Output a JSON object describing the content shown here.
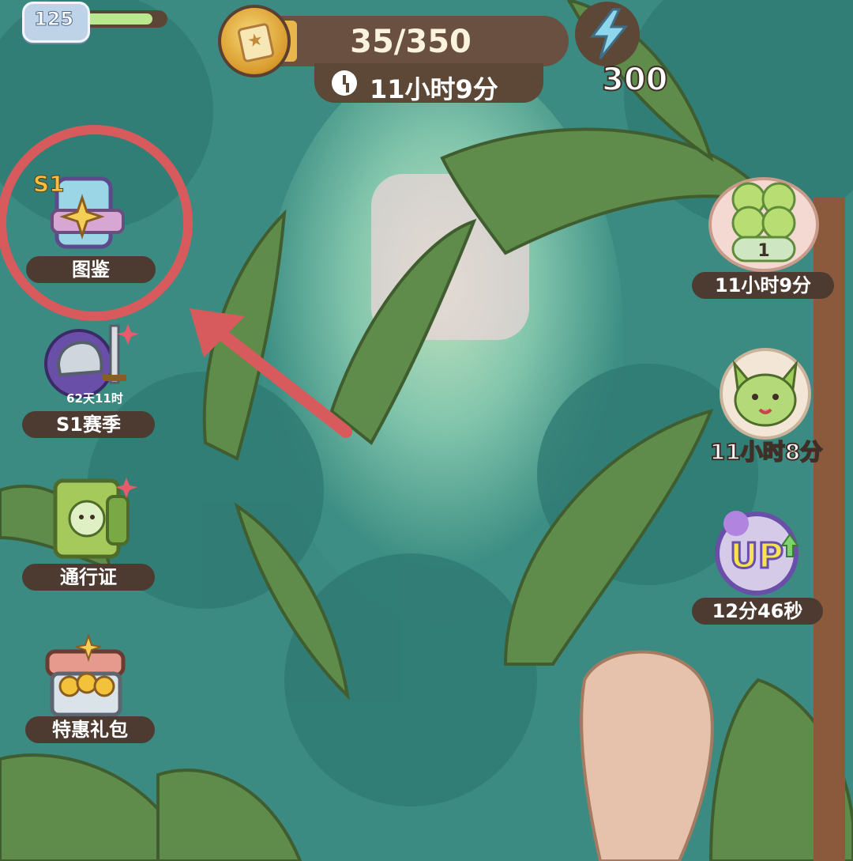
{
  "player": {
    "level": "125",
    "xp_fraction": 0.85
  },
  "energy_bar": {
    "progress_text": "35/350",
    "progress_fraction": 0.1,
    "refill_timer": "11小时9分"
  },
  "currency": {
    "energy_value": "300"
  },
  "left_menu": {
    "codex": {
      "badge": "S1",
      "label": "图鉴"
    },
    "season": {
      "timer": "62天11时",
      "label": "S1赛季"
    },
    "pass": {
      "label": "通行证"
    },
    "bundle": {
      "label": "特惠礼包"
    }
  },
  "right_menu": {
    "clover": {
      "count": "1",
      "timer": "11小时9分"
    },
    "pet": {
      "timer": "11小时8分"
    },
    "boost": {
      "badge_text": "UP",
      "timer": "12分46秒"
    }
  },
  "colors": {
    "highlight": "#d75a5d",
    "label_bg": "#4d3a31",
    "foliage": "#5f8c4a",
    "background": "#3d8f84"
  }
}
